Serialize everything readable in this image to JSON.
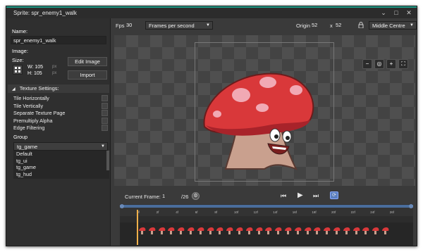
{
  "window": {
    "title": "Sprite: spr_enemy1_walk"
  },
  "left": {
    "name_label": "Name:",
    "name_value": "spr_enemy1_walk",
    "image_label": "Image:",
    "size_label": "Size:",
    "width_text": "W: 105",
    "width_unit": "px",
    "height_text": "H: 105",
    "height_unit": "px",
    "edit_image_label": "Edit Image",
    "import_label": "Import",
    "texture_settings_label": "Texture Settings:",
    "checks": [
      {
        "label": "Tile Horizontally"
      },
      {
        "label": "Tile Vertically"
      },
      {
        "label": "Separate Texture Page"
      },
      {
        "label": "Premultiply Alpha"
      },
      {
        "label": "Edge Filtering"
      }
    ],
    "group_label": "Group",
    "group_selected": "tg_game",
    "group_options": [
      "Default",
      "tg_ui",
      "tg_game",
      "tg_hud"
    ]
  },
  "toolbar": {
    "fps_label": "Fps",
    "fps_value": "30",
    "fps_mode": "Frames per second",
    "origin_label": "Origin",
    "origin_x": "52",
    "origin_sep": "x",
    "origin_y": "52",
    "origin_preset": "Middle Centre"
  },
  "frame": {
    "current_label": "Current Frame:",
    "current_value": "1",
    "total_text": "/26"
  },
  "timeline": {
    "ticks": [
      "0f",
      "2f",
      "4f",
      "6f",
      "8f",
      "10f",
      "12f",
      "14f",
      "16f",
      "18f",
      "20f",
      "22f",
      "24f",
      "26f"
    ],
    "frame_count": 26,
    "current_frame": 0
  },
  "colors": {
    "accent": "#1d9a86",
    "playhead": "#f0b04a",
    "mushroom_cap": "#d9383a",
    "mushroom_spot": "#f1a9b4",
    "stem": "#c9a08e"
  }
}
